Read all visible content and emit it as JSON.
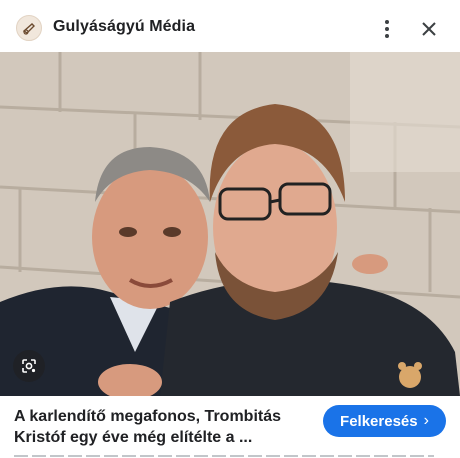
{
  "header": {
    "site_name": "Gulyáságyú Média",
    "logo_icon": "cannon-logo-icon",
    "more_icon": "more-vert-icon",
    "close_icon": "close-icon"
  },
  "image": {
    "description_icon": "google-lens-icon"
  },
  "result": {
    "title": "A karlendítő megafonos, Trombitás Kristóf egy éve még elítélte a ...",
    "visit_label": "Felkeresés",
    "visit_chevron": "›",
    "visit_color": "#1a73e8"
  }
}
